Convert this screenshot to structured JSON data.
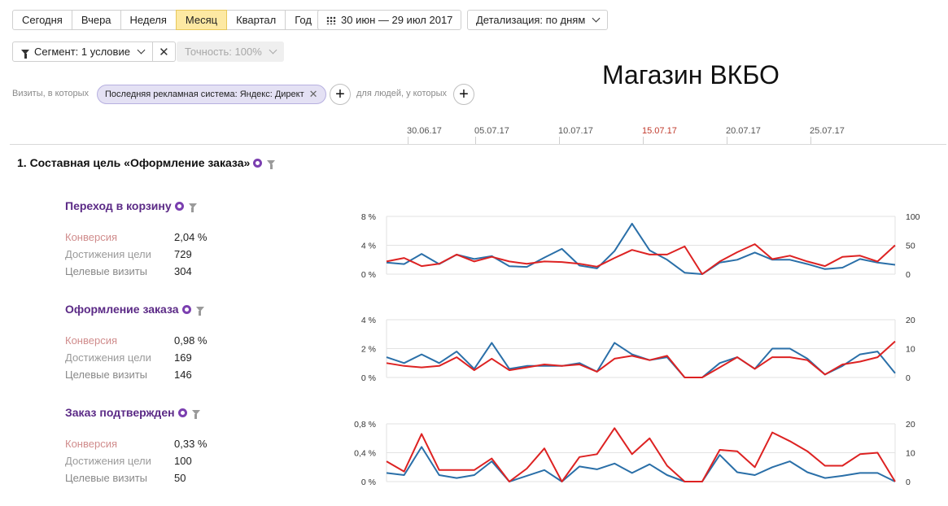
{
  "toolbar": {
    "periods": [
      "Сегодня",
      "Вчера",
      "Неделя",
      "Месяц",
      "Квартал",
      "Год"
    ],
    "active_period": "Месяц",
    "date_range": "30 июн — 29 июл 2017",
    "detail": "Детализация: по дням"
  },
  "segment": {
    "label": "Сегмент: 1 условие",
    "close": "✕",
    "accuracy": "Точность: 100%"
  },
  "conditions": {
    "visits_label": "Визиты, в которых",
    "chip": "Последняя рекламная система: Яндекс: Директ",
    "chip_remove": "✕",
    "people_label": "для людей, у которых",
    "plus": "+"
  },
  "store_title": "Магазин ВКБО",
  "timeline": {
    "dates": [
      "30.06.17",
      "05.07.17",
      "10.07.17",
      "15.07.17",
      "20.07.17",
      "25.07.17"
    ],
    "highlight": "15.07.17"
  },
  "section_title": "1.  Составная цель «Оформление заказа»",
  "metric_labels": {
    "conversion": "Конверсия",
    "reaches": "Достижения цели",
    "visits": "Целевые визиты"
  },
  "colors": {
    "red_series": "#dd2222",
    "blue_series": "#2a6fa8",
    "goal_title": "#5b2a86",
    "label_conversion": "#d08c8c",
    "label_reaches": "#9a9a9a",
    "label_visits": "#888888",
    "active_period_bg": "#fde9a3"
  },
  "goals": [
    {
      "title": "Переход в корзину",
      "conversion": "2,04 %",
      "reaches": "729",
      "visits": "304"
    },
    {
      "title": "Оформление заказа",
      "conversion": "0,98 %",
      "reaches": "169",
      "visits": "146"
    },
    {
      "title": "Заказ подтвержден",
      "conversion": "0,33 %",
      "reaches": "100",
      "visits": "50"
    }
  ],
  "chart_data": [
    {
      "type": "line",
      "left_axis_ticks": [
        "8 %",
        "4 %",
        "0 %"
      ],
      "right_axis_ticks": [
        "100",
        "50",
        "0"
      ],
      "ylim_left": [
        0,
        8
      ],
      "ylim_right": [
        0,
        100
      ],
      "x": [
        "30.06.17",
        "01.07.17",
        "02.07.17",
        "03.07.17",
        "04.07.17",
        "05.07.17",
        "06.07.17",
        "07.07.17",
        "08.07.17",
        "09.07.17",
        "10.07.17",
        "11.07.17",
        "12.07.17",
        "13.07.17",
        "14.07.17",
        "15.07.17",
        "16.07.17",
        "17.07.17",
        "18.07.17",
        "19.07.17",
        "20.07.17",
        "21.07.17",
        "22.07.17",
        "23.07.17",
        "24.07.17",
        "25.07.17",
        "26.07.17",
        "27.07.17",
        "28.07.17",
        "29.07.17"
      ],
      "series": [
        {
          "color": "#2a6fa8",
          "axis": "left",
          "values": [
            1.6,
            1.4,
            2.8,
            1.4,
            2.7,
            2.1,
            2.5,
            1.1,
            1.0,
            2.3,
            3.5,
            1.2,
            0.8,
            3.2,
            7.0,
            3.3,
            2.0,
            0.2,
            0.0,
            1.6,
            2.0,
            3.0,
            2.0,
            2.0,
            1.4,
            0.7,
            0.9,
            2.1,
            1.6,
            1.3
          ]
        },
        {
          "color": "#dd2222",
          "axis": "right",
          "values": [
            22,
            28,
            14,
            18,
            34,
            22,
            30,
            22,
            18,
            22,
            21,
            18,
            13,
            28,
            42,
            34,
            34,
            48,
            0,
            22,
            38,
            52,
            26,
            32,
            22,
            14,
            30,
            32,
            22,
            50
          ]
        }
      ]
    },
    {
      "type": "line",
      "left_axis_ticks": [
        "4 %",
        "2 %",
        "0 %"
      ],
      "right_axis_ticks": [
        "20",
        "10",
        "0"
      ],
      "ylim_left": [
        0,
        4
      ],
      "ylim_right": [
        0,
        20
      ],
      "x": [
        "30.06.17",
        "01.07.17",
        "02.07.17",
        "03.07.17",
        "04.07.17",
        "05.07.17",
        "06.07.17",
        "07.07.17",
        "08.07.17",
        "09.07.17",
        "10.07.17",
        "11.07.17",
        "12.07.17",
        "13.07.17",
        "14.07.17",
        "15.07.17",
        "16.07.17",
        "17.07.17",
        "18.07.17",
        "19.07.17",
        "20.07.17",
        "21.07.17",
        "22.07.17",
        "23.07.17",
        "24.07.17",
        "25.07.17",
        "26.07.17",
        "27.07.17",
        "28.07.17",
        "29.07.17"
      ],
      "series": [
        {
          "color": "#2a6fa8",
          "axis": "left",
          "values": [
            1.4,
            1.0,
            1.6,
            1.0,
            1.8,
            0.6,
            2.4,
            0.6,
            0.8,
            0.8,
            0.8,
            1.0,
            0.4,
            2.4,
            1.6,
            1.2,
            1.4,
            0.0,
            0.0,
            1.0,
            1.4,
            0.6,
            2.0,
            2.0,
            1.3,
            0.2,
            0.8,
            1.6,
            1.8,
            0.3
          ]
        },
        {
          "color": "#dd2222",
          "axis": "right",
          "values": [
            5,
            4,
            3.5,
            4,
            7,
            2.5,
            6.5,
            2.5,
            3.5,
            4.5,
            4,
            4.5,
            2,
            6.5,
            7.5,
            6,
            7.5,
            0,
            0,
            3.5,
            7,
            3,
            7,
            7,
            6,
            1,
            4.5,
            5.5,
            7,
            12.5
          ]
        }
      ]
    },
    {
      "type": "line",
      "left_axis_ticks": [
        "0,8 %",
        "0,4 %",
        "0 %"
      ],
      "right_axis_ticks": [
        "20",
        "10",
        "0"
      ],
      "ylim_left": [
        0,
        0.8
      ],
      "ylim_right": [
        0,
        20
      ],
      "x": [
        "30.06.17",
        "01.07.17",
        "02.07.17",
        "03.07.17",
        "04.07.17",
        "05.07.17",
        "06.07.17",
        "07.07.17",
        "08.07.17",
        "09.07.17",
        "10.07.17",
        "11.07.17",
        "12.07.17",
        "13.07.17",
        "14.07.17",
        "15.07.17",
        "16.07.17",
        "17.07.17",
        "18.07.17",
        "19.07.17",
        "20.07.17",
        "21.07.17",
        "22.07.17",
        "23.07.17",
        "24.07.17",
        "25.07.17",
        "26.07.17",
        "27.07.17",
        "28.07.17",
        "29.07.17"
      ],
      "series": [
        {
          "color": "#2a6fa8",
          "axis": "left",
          "values": [
            0.12,
            0.09,
            0.48,
            0.09,
            0.05,
            0.09,
            0.28,
            0.0,
            0.08,
            0.16,
            0.0,
            0.21,
            0.17,
            0.25,
            0.12,
            0.24,
            0.09,
            0.0,
            0.0,
            0.37,
            0.13,
            0.09,
            0.2,
            0.28,
            0.13,
            0.05,
            0.08,
            0.12,
            0.12,
            0.0
          ]
        },
        {
          "color": "#dd2222",
          "axis": "right",
          "values": [
            7,
            3.5,
            16.5,
            4,
            4,
            4,
            8,
            0,
            4.5,
            11.5,
            0,
            8.5,
            9.5,
            18.5,
            9.5,
            15,
            5.5,
            0,
            0,
            11,
            10.5,
            5,
            17,
            14,
            10.5,
            5.5,
            5.5,
            9.5,
            10,
            0
          ]
        }
      ]
    }
  ]
}
